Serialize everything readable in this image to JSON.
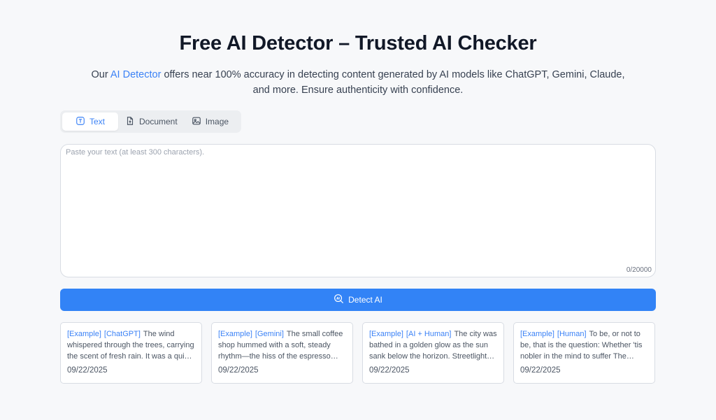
{
  "header": {
    "title": "Free AI Detector – Trusted AI Checker",
    "subtitle_prefix": "Our ",
    "subtitle_link": "AI Detector",
    "subtitle_rest": " offers near 100% accuracy in detecting content generated by AI models like ChatGPT, Gemini, Claude, and more. Ensure authenticity with confidence."
  },
  "tabs": [
    {
      "label": "Text",
      "icon": "text-icon",
      "active": true
    },
    {
      "label": "Document",
      "icon": "document-icon",
      "active": false
    },
    {
      "label": "Image",
      "icon": "image-icon",
      "active": false
    }
  ],
  "input": {
    "placeholder": "Paste your text (at least 300 characters).",
    "value": "",
    "counter": "0/20000"
  },
  "detect_button": {
    "label": "Detect AI",
    "icon": "ai-search-icon"
  },
  "examples": [
    {
      "tags": [
        "[Example]",
        "[ChatGPT]"
      ],
      "text": "The wind whispered through the trees, carrying the scent of fresh rain. It was a quiet evening in the small village.",
      "date": "09/22/2025"
    },
    {
      "tags": [
        "[Example]",
        "[Gemini]"
      ],
      "text": "The small coffee shop hummed with a soft, steady rhythm—the hiss of the espresso machine and the murmur of voices.",
      "date": "09/22/2025"
    },
    {
      "tags": [
        "[Example]",
        "[AI + Human]"
      ],
      "text": "The city was bathed in a golden glow as the sun sank below the horizon. Streetlights flickered on one by one.",
      "date": "09/22/2025"
    },
    {
      "tags": [
        "[Example]",
        "[Human]"
      ],
      "text": "To be, or not to be, that is the question: Whether 'tis nobler in the mind to suffer The slings and arrows of outrageous fortune.",
      "date": "09/22/2025"
    }
  ],
  "colors": {
    "accent": "#3283f6",
    "background": "#f7f8fa"
  }
}
